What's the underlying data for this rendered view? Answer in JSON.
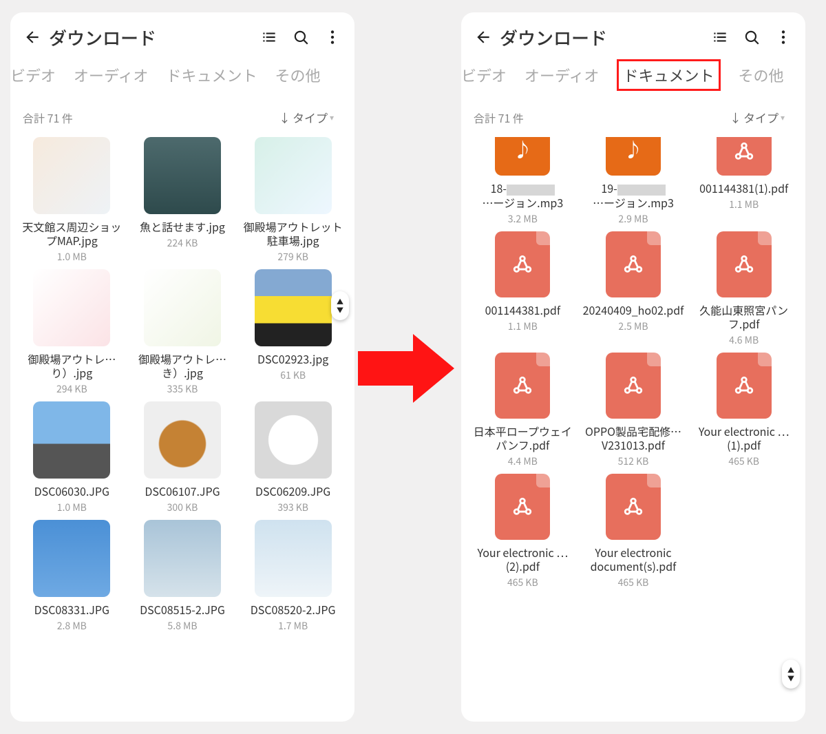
{
  "left": {
    "header": {
      "title": "ダウンロード"
    },
    "tabs": [
      "ビデオ",
      "オーディオ",
      "ドキュメント",
      "その他"
    ],
    "summary": {
      "count": "合計 71 件",
      "sort": "タイプ"
    },
    "files": [
      {
        "name": "天文館ス周辺ショップMAP.jpg",
        "size": "1.0 MB",
        "thumb": "t-map1"
      },
      {
        "name": "魚と話せます.jpg",
        "size": "224 KB",
        "thumb": "t-water"
      },
      {
        "name": "御殿場アウトレット駐車場.jpg",
        "size": "279 KB",
        "thumb": "t-map2"
      },
      {
        "name": "御殿場アウトレ…り）.jpg",
        "size": "294 KB",
        "thumb": "t-line1"
      },
      {
        "name": "御殿場アウトレ…き）.jpg",
        "size": "335 KB",
        "thumb": "t-line2"
      },
      {
        "name": "DSC02923.jpg",
        "size": "61 KB",
        "thumb": "t-car"
      },
      {
        "name": "DSC06030.JPG",
        "size": "1.0 MB",
        "thumb": "t-castle"
      },
      {
        "name": "DSC06107.JPG",
        "size": "300 KB",
        "thumb": "t-food1"
      },
      {
        "name": "DSC06209.JPG",
        "size": "393 KB",
        "thumb": "t-food2"
      },
      {
        "name": "DSC08331.JPG",
        "size": "2.8 MB",
        "thumb": "t-sky1"
      },
      {
        "name": "DSC08515-2.JPG",
        "size": "5.8 MB",
        "thumb": "t-sky2"
      },
      {
        "name": "DSC08520-2.JPG",
        "size": "1.7 MB",
        "thumb": "t-sky3"
      }
    ]
  },
  "right": {
    "header": {
      "title": "ダウンロード"
    },
    "tabs": [
      "ビデオ",
      "オーディオ",
      "ドキュメント",
      "その他"
    ],
    "summary": {
      "count": "合計 71 件",
      "sort": "タイプ"
    },
    "files": [
      {
        "name_pre": "18-",
        "name_post": "…ージョン.mp3",
        "size": "3.2 MB",
        "kind": "mp3",
        "partial": true,
        "redact": true
      },
      {
        "name_pre": "19-",
        "name_post": "…ージョン.mp3",
        "size": "2.9 MB",
        "kind": "mp3",
        "partial": true,
        "redact": true
      },
      {
        "name": "001144381(1).pdf",
        "size": "1.1 MB",
        "kind": "pdf",
        "partial": true
      },
      {
        "name": "001144381.pdf",
        "size": "1.1 MB",
        "kind": "pdf"
      },
      {
        "name": "20240409_ho02.pdf",
        "size": "2.5 MB",
        "kind": "pdf"
      },
      {
        "name": "久能山東照宮パンフ.pdf",
        "size": "4.6 MB",
        "kind": "pdf"
      },
      {
        "name": "日本平ロープウェイパンフ.pdf",
        "size": "4.4 MB",
        "kind": "pdf"
      },
      {
        "name": "OPPO製品宅配修…V231013.pdf",
        "size": "512 KB",
        "kind": "pdf"
      },
      {
        "name": "Your electronic …(1).pdf",
        "size": "465 KB",
        "kind": "pdf"
      },
      {
        "name": "Your electronic …(2).pdf",
        "size": "465 KB",
        "kind": "pdf"
      },
      {
        "name": "Your electronic document(s).pdf",
        "size": "465 KB",
        "kind": "pdf"
      }
    ]
  }
}
